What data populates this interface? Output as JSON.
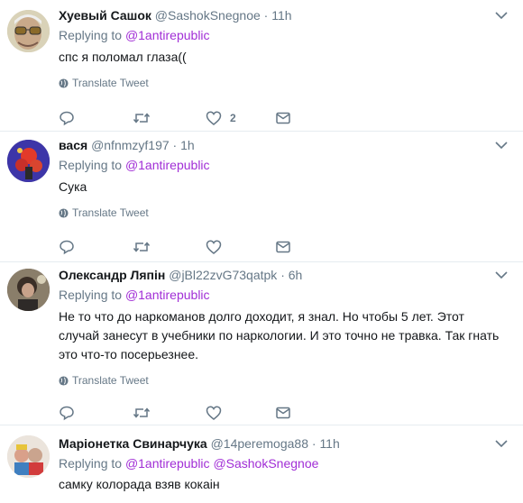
{
  "tweets": [
    {
      "name": "Хуевый Сашок",
      "handle": "@SashokSnegnoe",
      "sep": "·",
      "time": "11h",
      "replying_prefix": "Replying to",
      "replying_to": [
        "@1antirepublic"
      ],
      "lines": [
        "спс я поломал глаза(("
      ],
      "translate": "Translate Tweet",
      "like_count": "2"
    },
    {
      "name": "вася",
      "handle": "@nfnmzyf197",
      "sep": "·",
      "time": "1h",
      "replying_prefix": "Replying to",
      "replying_to": [
        "@1antirepublic"
      ],
      "lines": [
        "Сука"
      ],
      "translate": "Translate Tweet",
      "like_count": ""
    },
    {
      "name": "Олександр Ляпін",
      "handle": "@jBl22zvG73qatpk",
      "sep": "·",
      "time": "6h",
      "replying_prefix": "Replying to",
      "replying_to": [
        "@1antirepublic"
      ],
      "lines": [
        "Не то что до наркоманов долго доходит, я знал. Но чтобы 5 лет. Этот",
        "случай занесут в учебники по наркологии. И это точно не травка. Так гнать",
        "это что-то посерьезнее."
      ],
      "translate": "Translate Tweet",
      "like_count": ""
    },
    {
      "name": "Маріонетка Свинарчука",
      "handle": "@14peremoga88",
      "sep": "·",
      "time": "11h",
      "replying_prefix": "Replying to",
      "replying_to": [
        "@1antirepublic",
        "@SashokSnegnoe"
      ],
      "lines": [
        "самку колорада взяв кокаін"
      ],
      "translate": "",
      "like_count": ""
    }
  ],
  "colors": {
    "link": "#a12ed6",
    "muted": "#657786",
    "text": "#14171a",
    "border": "#e6ecf0"
  },
  "icons": [
    "reply-icon",
    "retweet-icon",
    "like-icon",
    "direct-message-icon",
    "globe-icon",
    "chevron-down-icon"
  ]
}
